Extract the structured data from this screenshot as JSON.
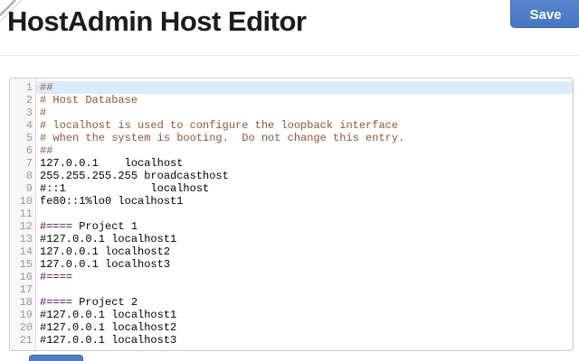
{
  "header": {
    "title": "HostAdmin Host Editor",
    "save_label": "Save"
  },
  "colors": {
    "accent_blue": "#4d7fc7",
    "comment": "#a0522d",
    "group_delimiter": "#770088",
    "active_line_bg": "#dcebfa",
    "line_number": "#999999"
  },
  "editor": {
    "lines": [
      {
        "num": "1",
        "active": true,
        "tokens": [
          {
            "text": "##",
            "type": "comment"
          }
        ]
      },
      {
        "num": "2",
        "active": false,
        "tokens": [
          {
            "text": "# Host Database",
            "type": "comment"
          }
        ]
      },
      {
        "num": "3",
        "active": false,
        "tokens": [
          {
            "text": "#",
            "type": "comment"
          }
        ]
      },
      {
        "num": "4",
        "active": false,
        "tokens": [
          {
            "text": "# localhost is used to configure the loopback interface",
            "type": "comment"
          }
        ]
      },
      {
        "num": "5",
        "active": false,
        "tokens": [
          {
            "text": "# when the system is booting.  Do not change this entry.",
            "type": "comment"
          }
        ]
      },
      {
        "num": "6",
        "active": false,
        "tokens": [
          {
            "text": "##",
            "type": "comment"
          }
        ]
      },
      {
        "num": "7",
        "active": false,
        "tokens": [
          {
            "text": "127.0.0.1    localhost",
            "type": "plain"
          }
        ]
      },
      {
        "num": "8",
        "active": false,
        "tokens": [
          {
            "text": "255.255.255.255 broadcasthost",
            "type": "plain"
          }
        ]
      },
      {
        "num": "9",
        "active": false,
        "tokens": [
          {
            "text": "#::1             localhost",
            "type": "plain"
          }
        ]
      },
      {
        "num": "10",
        "active": false,
        "tokens": [
          {
            "text": "fe80::1%lo0 localhost1",
            "type": "plain"
          }
        ]
      },
      {
        "num": "11",
        "active": false,
        "tokens": []
      },
      {
        "num": "12",
        "active": false,
        "tokens": [
          {
            "text": "#====",
            "type": "delim"
          },
          {
            "text": " Project 1",
            "type": "plain"
          }
        ]
      },
      {
        "num": "13",
        "active": false,
        "tokens": [
          {
            "text": "#127.0.0.1 localhost1",
            "type": "plain"
          }
        ]
      },
      {
        "num": "14",
        "active": false,
        "tokens": [
          {
            "text": "127.0.0.1 localhost2",
            "type": "plain"
          }
        ]
      },
      {
        "num": "15",
        "active": false,
        "tokens": [
          {
            "text": "127.0.0.1 localhost3",
            "type": "plain"
          }
        ]
      },
      {
        "num": "16",
        "active": false,
        "tokens": [
          {
            "text": "#====",
            "type": "delim"
          }
        ]
      },
      {
        "num": "17",
        "active": false,
        "tokens": []
      },
      {
        "num": "18",
        "active": false,
        "tokens": [
          {
            "text": "#====",
            "type": "delim"
          },
          {
            "text": " Project 2",
            "type": "plain"
          }
        ]
      },
      {
        "num": "19",
        "active": false,
        "tokens": [
          {
            "text": "#127.0.0.1 localhost1",
            "type": "plain"
          }
        ]
      },
      {
        "num": "20",
        "active": false,
        "tokens": [
          {
            "text": "#127.0.0.1 localhost2",
            "type": "plain"
          }
        ]
      },
      {
        "num": "21",
        "active": false,
        "tokens": [
          {
            "text": "#127.0.0.1 localhost3",
            "type": "plain"
          }
        ]
      }
    ]
  }
}
